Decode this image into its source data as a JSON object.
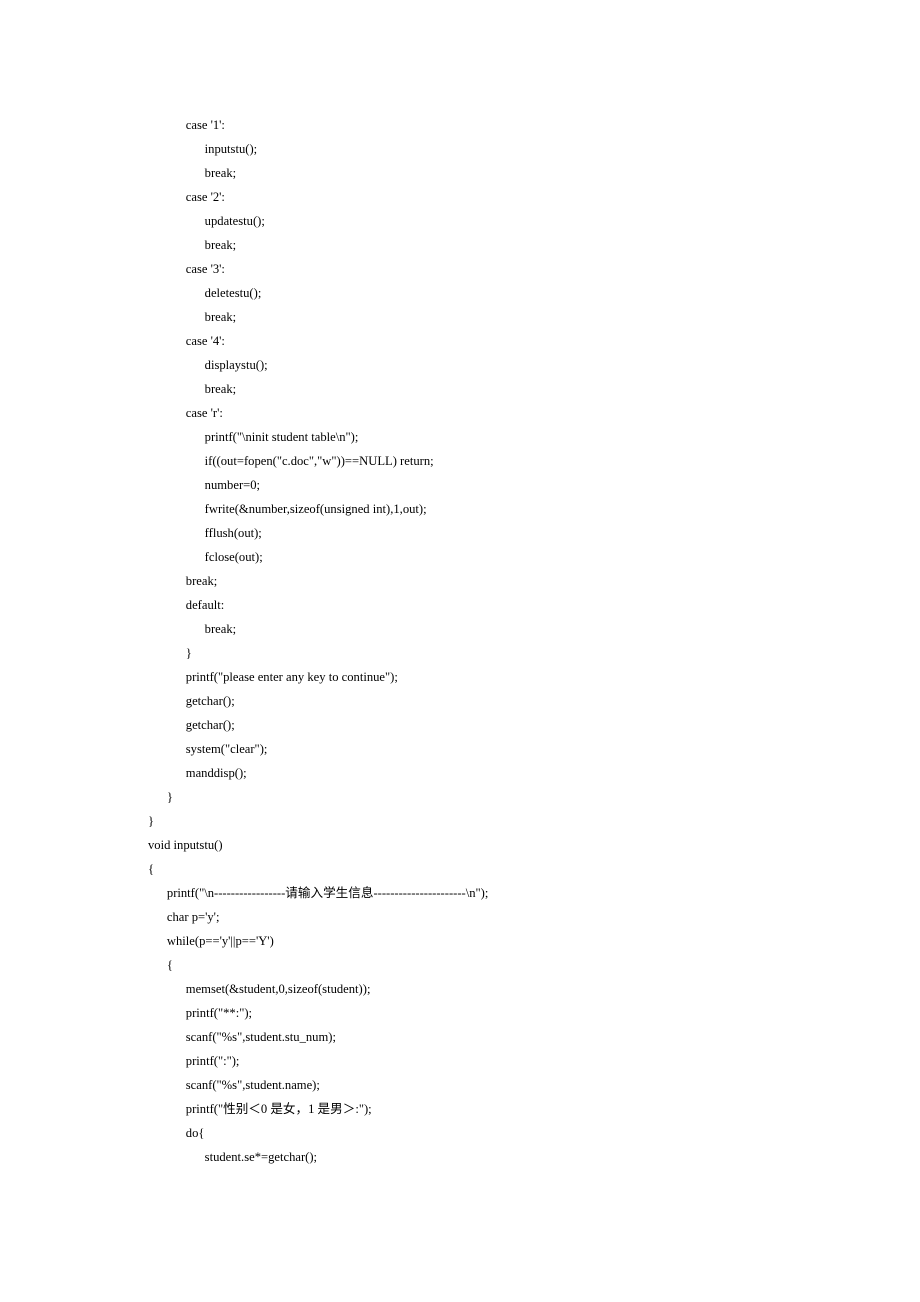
{
  "code_lines": [
    "            case '1':",
    "                  inputstu();",
    "                  break;",
    "            case '2':",
    "                  updatestu();",
    "                  break;",
    "            case '3':",
    "                  deletestu();",
    "                  break;",
    "            case '4':",
    "                  displaystu();",
    "                  break;",
    "            case 'r':",
    "                  printf(\"\\ninit student table\\n\");",
    "                  if((out=fopen(\"c.doc\",\"w\"))==NULL) return;",
    "                  number=0;",
    "                  fwrite(&number,sizeof(unsigned int),1,out);",
    "                  fflush(out);",
    "                  fclose(out);",
    "            break;",
    "            default:",
    "                  break;",
    "            }",
    "            printf(\"please enter any key to continue\");",
    "            getchar();",
    "            getchar();",
    "            system(\"clear\");",
    "            manddisp();",
    "      }",
    "}",
    "void inputstu()",
    "{",
    "      printf(\"\\n-----------------请输入学生信息----------------------\\n\");",
    "      char p='y';",
    "      while(p=='y'||p=='Y')",
    "      {",
    "            memset(&student,0,sizeof(student));",
    "            printf(\"**:\");",
    "            scanf(\"%s\",student.stu_num);",
    "            printf(\":\");",
    "            scanf(\"%s\",student.name);",
    "            printf(\"性别＜0 是女，1 是男＞:\");",
    "            do{",
    "                  student.se*=getchar();"
  ]
}
